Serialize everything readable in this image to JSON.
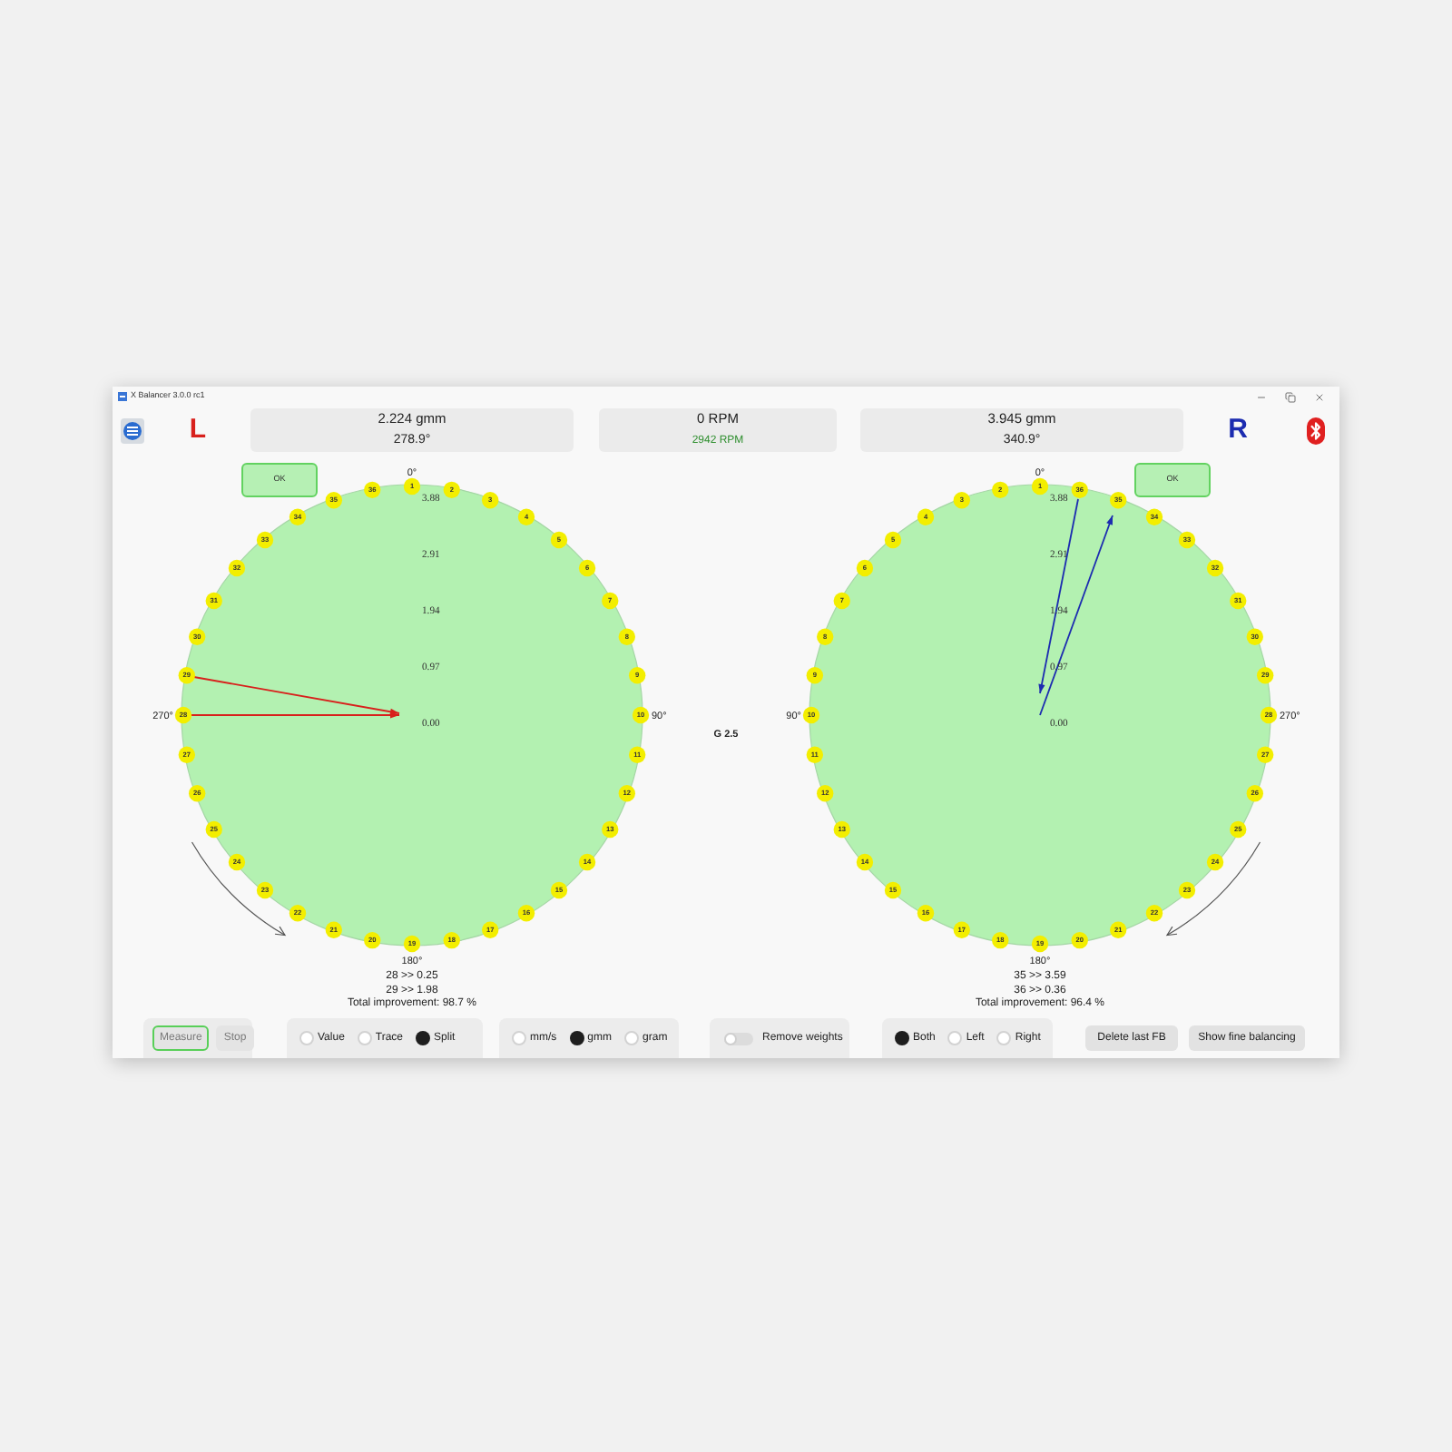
{
  "window": {
    "title": "X Balancer 3.0.0 rc1"
  },
  "planes": [
    {
      "letter": "L",
      "color": "#d8201c",
      "amount": "2.224 gmm",
      "angle": "278.9°",
      "mirrored": false,
      "ok_label": "OK",
      "angle_labels": {
        "top": "0°",
        "right": "90°",
        "bottom": "180°",
        "left": "270°"
      },
      "scale": [
        "3.88",
        "2.91",
        "1.94",
        "0.97",
        "0.00"
      ],
      "left_half_markers": [
        "36",
        "35",
        "34",
        "33",
        "32",
        "31",
        "30",
        "29",
        "28",
        "27",
        "26",
        "25",
        "24",
        "23",
        "22",
        "21",
        "20"
      ],
      "right_half_markers": [
        "1",
        "2",
        "3",
        "4",
        "5",
        "6",
        "7",
        "8",
        "9",
        "10",
        "11",
        "12",
        "13",
        "14",
        "15",
        "16",
        "17",
        "18",
        "19"
      ],
      "corrections": [
        "28 >> 0.25",
        "29 >> 1.98"
      ],
      "improvement": "Total improvement: 98.7 %"
    },
    {
      "letter": "R",
      "color": "#1c2cb0",
      "amount": "3.945 gmm",
      "angle": "340.9°",
      "mirrored": true,
      "ok_label": "OK",
      "angle_labels": {
        "top": "0°",
        "left": "90°",
        "bottom": "180°",
        "right": "270°"
      },
      "scale": [
        "3.88",
        "2.91",
        "1.94",
        "0.97",
        "0.00"
      ],
      "left_half_markers": [
        "1",
        "2",
        "3",
        "4",
        "5",
        "6",
        "7",
        "8",
        "9",
        "10",
        "11",
        "12",
        "13",
        "14",
        "15",
        "16",
        "17",
        "18",
        "19"
      ],
      "right_half_markers": [
        "36",
        "35",
        "34",
        "33",
        "32",
        "31",
        "30",
        "29",
        "28",
        "27",
        "26",
        "25",
        "24",
        "23",
        "22",
        "21",
        "20"
      ],
      "corrections": [
        "35 >> 3.59",
        "36 >> 0.36"
      ],
      "improvement": "Total improvement: 96.4 %"
    }
  ],
  "speed": {
    "current": "0 RPM",
    "measured": "2942 RPM"
  },
  "grade": "G 2.5",
  "bottom_bar": [
    {
      "kind": "buttons",
      "buttons": [
        {
          "label": "Measure",
          "disabled": true,
          "highlighted": true
        },
        {
          "label": "Stop",
          "disabled": true,
          "highlighted": false
        }
      ]
    },
    {
      "kind": "radio",
      "options": [
        {
          "label": "Value",
          "selected": false
        },
        {
          "label": "Trace",
          "selected": false
        },
        {
          "label": "Split",
          "selected": true
        }
      ]
    },
    {
      "kind": "radio",
      "options": [
        {
          "label": "mm/s",
          "selected": false
        },
        {
          "label": "gmm",
          "selected": true
        },
        {
          "label": "gram",
          "selected": false
        }
      ]
    },
    {
      "kind": "toggle",
      "label": "Remove weights",
      "on": false
    },
    {
      "kind": "radio",
      "options": [
        {
          "label": "Both",
          "selected": true
        },
        {
          "label": "Left",
          "selected": false
        },
        {
          "label": "Right",
          "selected": false
        }
      ]
    },
    {
      "kind": "button",
      "label": "Delete last FB"
    },
    {
      "kind": "button",
      "label": "Show fine balancing"
    }
  ]
}
